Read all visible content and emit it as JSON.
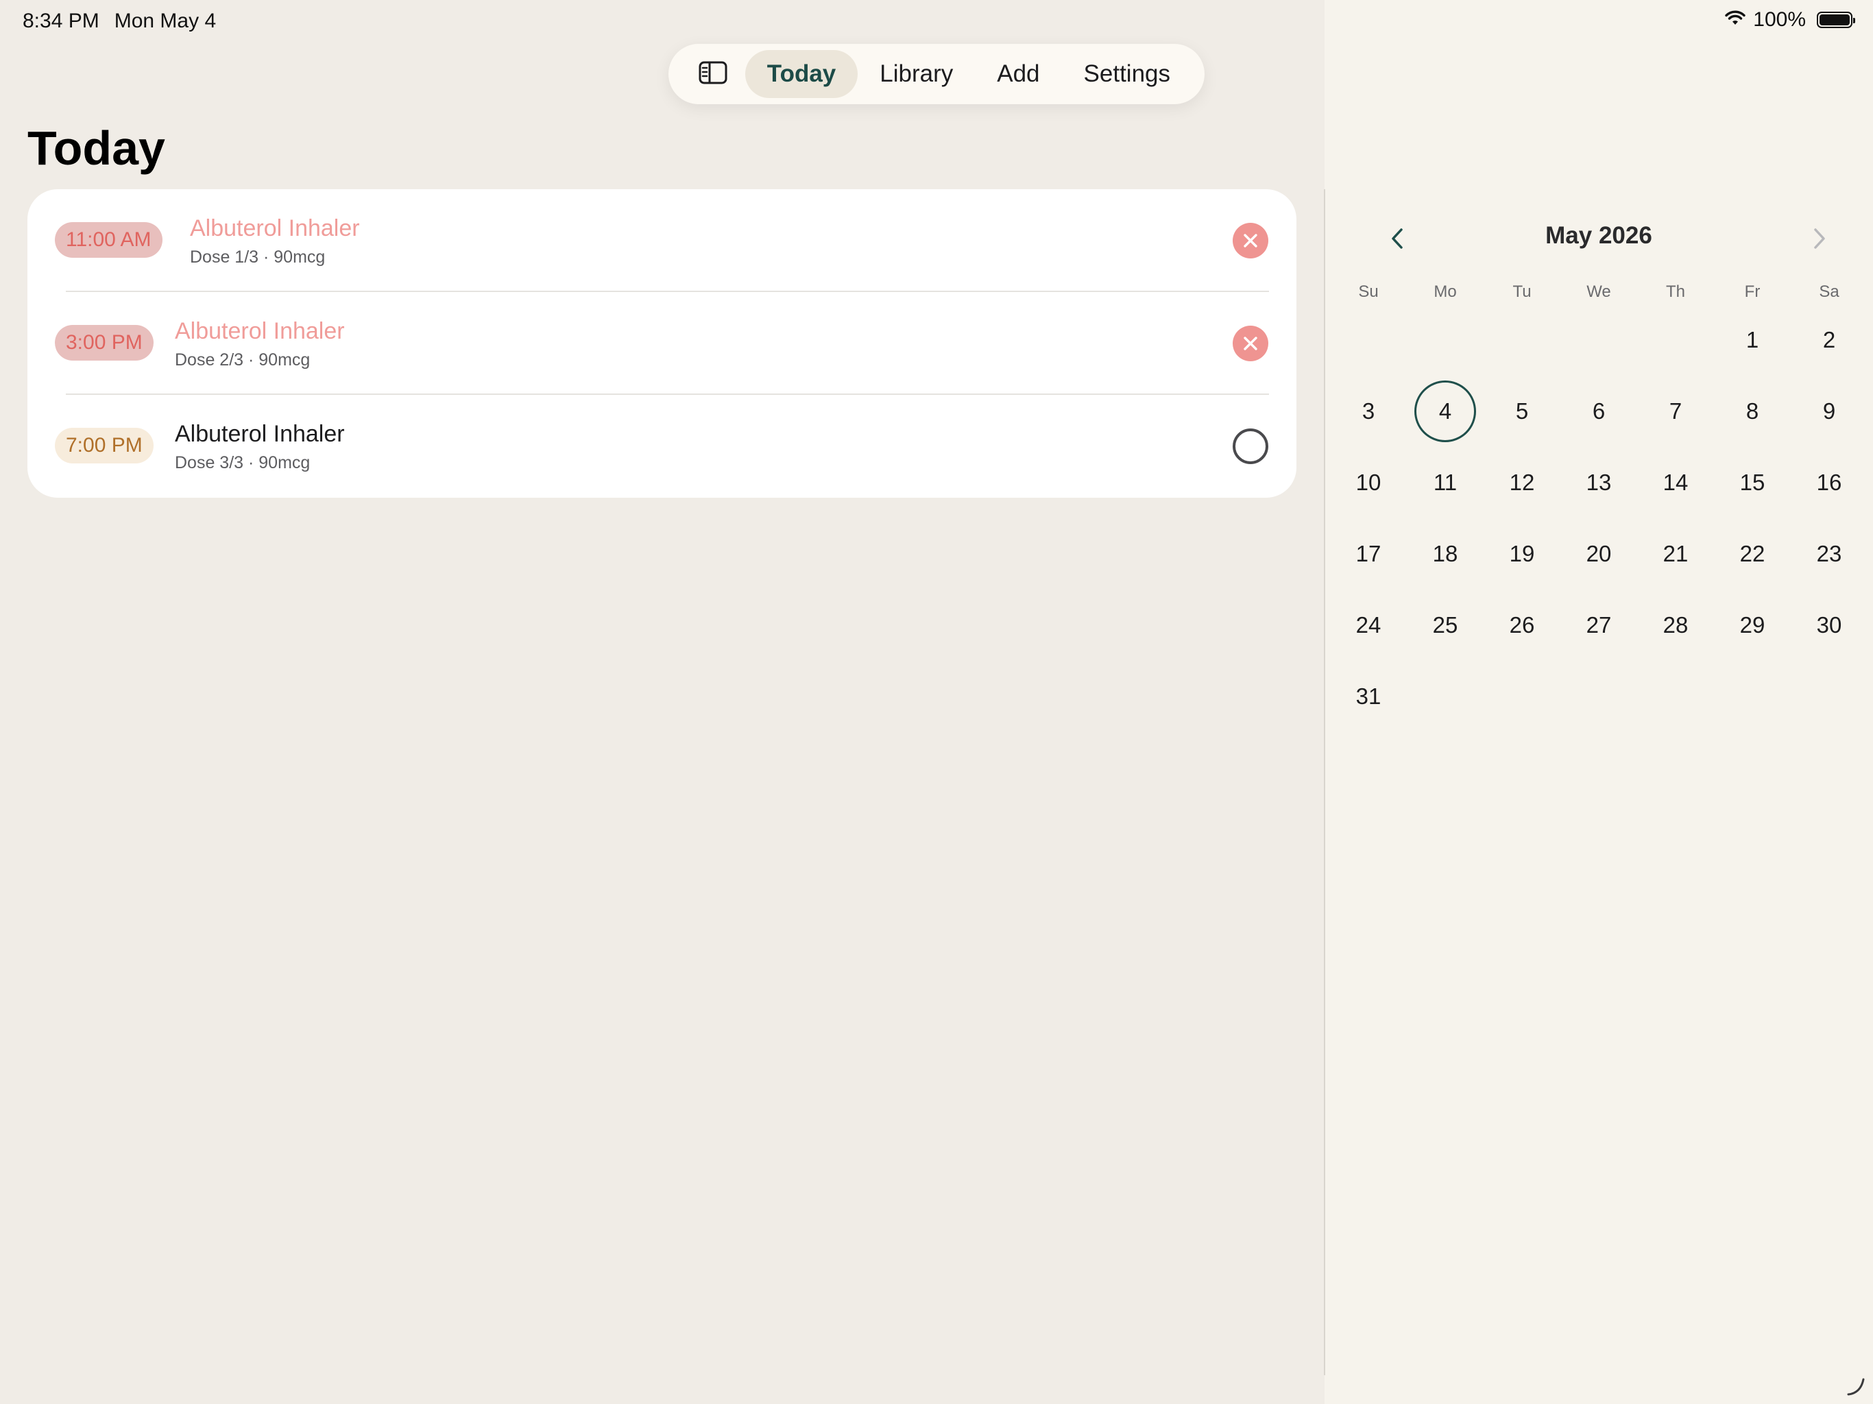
{
  "status_bar": {
    "time": "8:34 PM",
    "date": "Mon May 4",
    "battery": "100%",
    "icons": [
      "wifi-icon",
      "battery-icon"
    ]
  },
  "tabbar": {
    "sidebar_toggle_icon": "sidebar-icon",
    "tabs": [
      {
        "label": "Today",
        "active": true
      },
      {
        "label": "Library",
        "active": false
      },
      {
        "label": "Add",
        "active": false
      },
      {
        "label": "Settings",
        "active": false
      }
    ]
  },
  "page": {
    "title": "Today"
  },
  "doses": [
    {
      "time": "11:00 AM",
      "name": "Albuterol Inhaler",
      "detail": "Dose 1/3 · 90mcg",
      "status": "missed",
      "status_icon": "x-mark-icon"
    },
    {
      "time": "3:00 PM",
      "name": "Albuterol Inhaler",
      "detail": "Dose 2/3 · 90mcg",
      "status": "missed",
      "status_icon": "x-mark-icon"
    },
    {
      "time": "7:00 PM",
      "name": "Albuterol Inhaler",
      "detail": "Dose 3/3 · 90mcg",
      "status": "pending",
      "status_icon": "empty-circle-icon"
    }
  ],
  "calendar": {
    "month_title": "May 2026",
    "prev_icon": "chevron-left-icon",
    "next_icon": "chevron-right-icon",
    "weekdays": [
      "Su",
      "Mo",
      "Tu",
      "We",
      "Th",
      "Fr",
      "Sa"
    ],
    "weeks": [
      [
        "",
        "",
        "",
        "",
        "",
        "1",
        "2"
      ],
      [
        "3",
        "4",
        "5",
        "6",
        "7",
        "8",
        "9"
      ],
      [
        "10",
        "11",
        "12",
        "13",
        "14",
        "15",
        "16"
      ],
      [
        "17",
        "18",
        "19",
        "20",
        "21",
        "22",
        "23"
      ],
      [
        "24",
        "25",
        "26",
        "27",
        "28",
        "29",
        "30"
      ],
      [
        "31",
        "",
        "",
        "",
        "",
        "",
        ""
      ]
    ],
    "selected_day": "4"
  },
  "colors": {
    "accent": "#1f4f4b",
    "missed": "#e0645f",
    "upcoming": "#b0702a",
    "background": "#f0ece6"
  }
}
